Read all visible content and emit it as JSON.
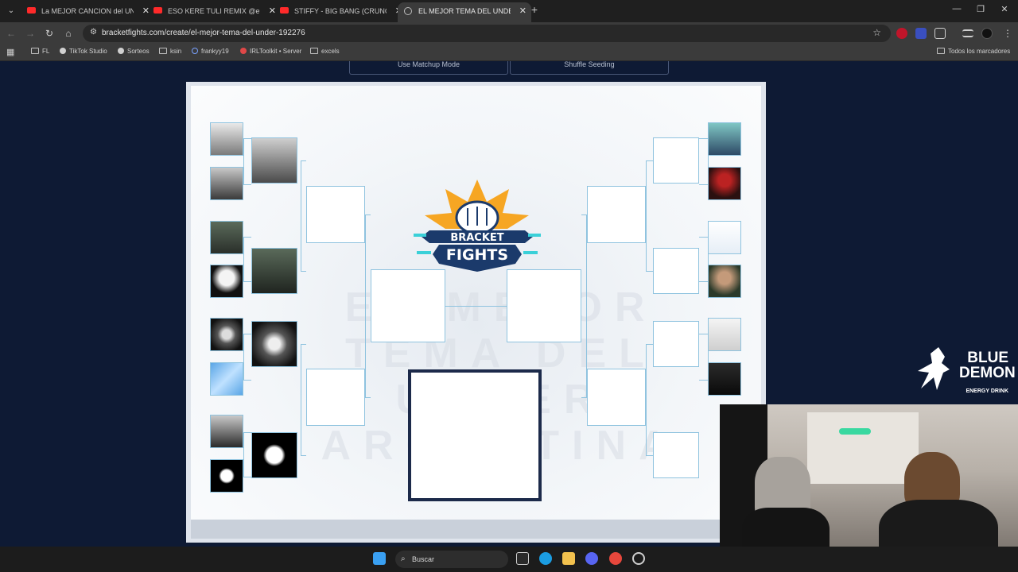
{
  "browser": {
    "tabs": [
      {
        "title": "La MEJOR CANCION del UNDER",
        "favicon": "youtube-icon",
        "active": false
      },
      {
        "title": "ESO KERE TULI REMIX @enzocs",
        "favicon": "youtube-icon",
        "active": false
      },
      {
        "title": "STIFFY - BIG BANG (CRUNCHT",
        "favicon": "youtube-icon",
        "active": false
      },
      {
        "title": "EL MEJOR TEMA DEL UNDER B",
        "favicon": "globe-icon",
        "active": true
      }
    ],
    "url": "bracketfights.com/create/el-mejor-tema-del-under-192276",
    "bookmarks": [
      "FL",
      "TikTok Studio",
      "Sorteos",
      "ksin",
      "frankyy19",
      "IRLToolkit • Server",
      "excels"
    ],
    "bookmarks_right": "Todos los marcadores"
  },
  "page": {
    "buttons": [
      "Use Matchup Mode",
      "Shuffle Seeding"
    ],
    "logo": {
      "line1": "BRACKET",
      "line2": "FIGHTS"
    },
    "watermark": [
      "EL MEJOR TEMA DEL",
      "UNDER ARGENTINA"
    ]
  },
  "overlay": {
    "brand": "BLUE DEMON",
    "brand_line1": "BLUE",
    "brand_line2": "DEMON",
    "tagline": "ENERGY DRINK"
  },
  "taskbar": {
    "search_placeholder": "Buscar"
  },
  "colors": {
    "slot_border": "#8fc3df",
    "page_bg": "#0e1a34",
    "accent_star": "#f6a623",
    "logo_blue": "#1b3a6b"
  }
}
